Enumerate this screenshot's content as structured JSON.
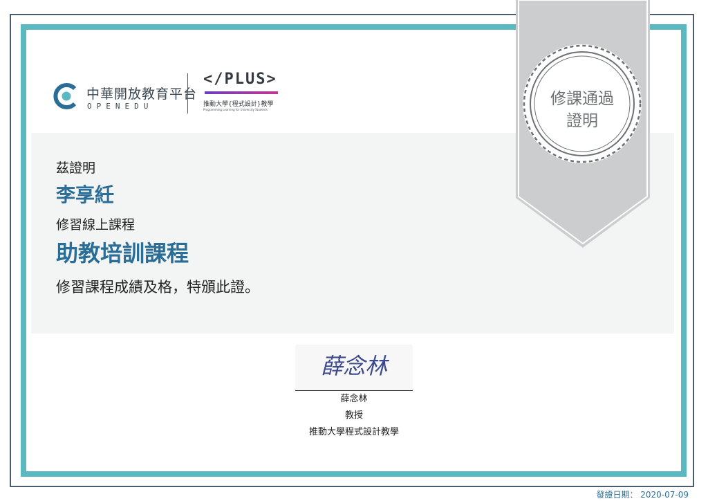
{
  "logos": {
    "openedu_name": "中華開放教育平台",
    "openedu_sub": "OPENEDU",
    "plus_name": "</PLUS>",
    "plus_sub": "推動大學{程式設計}教學",
    "plus_tagline": "Programming Learning for University Students"
  },
  "badge": {
    "line1": "修課通過",
    "line2": "證明"
  },
  "certificate": {
    "certify_label": "茲證明",
    "recipient_name": "李享紝",
    "course_label": "修習線上課程",
    "course_name": "助教培訓課程",
    "statement": "修習課程成績及格，特頒此證。"
  },
  "signature": {
    "handwritten": "薛念林",
    "name": "薛念林",
    "title": "教授",
    "organization": "推動大學程式設計教學"
  },
  "footer": {
    "issue_date": "發證日期： 2020-07-09"
  },
  "colors": {
    "accent_teal": "#5ab8c0",
    "name_blue": "#2a6d96",
    "ribbon_gray": "#cccdcf",
    "panel_bg": "#f3f4f4"
  }
}
